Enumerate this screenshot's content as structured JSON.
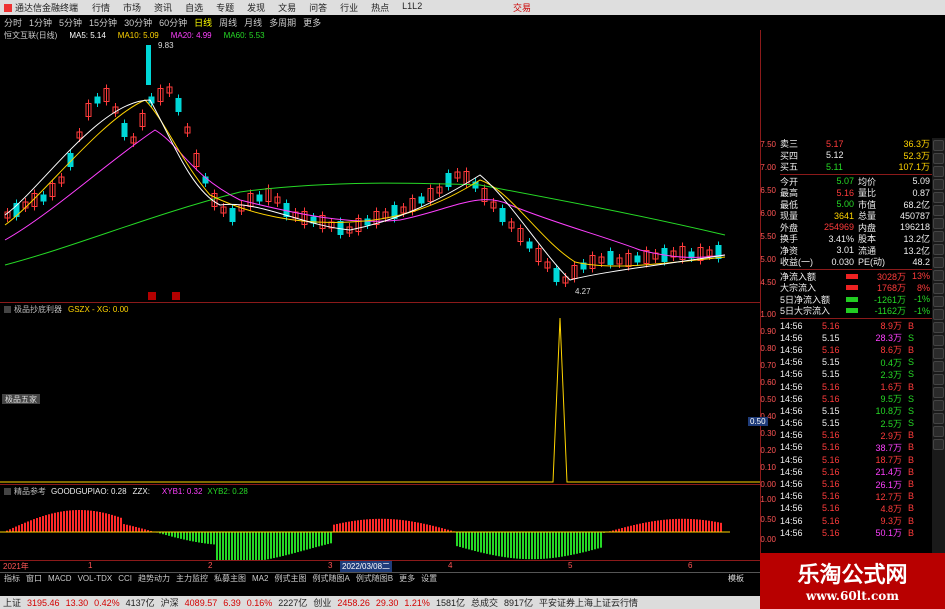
{
  "titlebar": {
    "app_title": "通达信金融终端",
    "menus": [
      "行情",
      "市场",
      "资讯",
      "自选",
      "专题",
      "发现",
      "文易",
      "问答",
      "行业",
      "热点",
      "L1L2"
    ],
    "close": "交易"
  },
  "periodbar": {
    "items": [
      "分时",
      "1分钟",
      "5分钟",
      "15分钟",
      "30分钟",
      "60分钟",
      "日线",
      "周线",
      "月线",
      "多周期",
      "更多"
    ],
    "active": "日线"
  },
  "main_chart": {
    "stock_title": "恒文互联(日线)",
    "ma": [
      {
        "label": "MA5: 5.14",
        "color": "#ffffff"
      },
      {
        "label": "MA10: 5.09",
        "color": "#ffd400"
      },
      {
        "label": "MA20: 4.99",
        "color": "#ff40ff"
      },
      {
        "label": "MA60: 5.53",
        "color": "#26d926"
      }
    ],
    "high_label": "9.83",
    "low_label": "4.27",
    "prices": [
      "7.50",
      "7.00",
      "6.50",
      "6.00",
      "5.50",
      "5.00",
      "4.50"
    ]
  },
  "chart_data": {
    "type": "candlestick",
    "title": "恒文互联(日线)",
    "ma_lines": [
      "MA5",
      "MA10",
      "MA20",
      "MA60"
    ],
    "ma_values": [
      5.14,
      5.09,
      4.99,
      5.53
    ],
    "high": 9.83,
    "low": 4.27
  },
  "sub1": {
    "title": "极品抄底利器",
    "formula": "GSZX - XG: 0.00",
    "axis": [
      "1.00",
      "0.90",
      "0.80",
      "0.70",
      "0.60",
      "0.50",
      "0.40",
      "0.30",
      "0.20",
      "0.10",
      "0.00"
    ],
    "cursor_value": "0.50",
    "tag_label": "极品五家"
  },
  "sub2": {
    "title": "精品参考",
    "formula": "GOODGUPIAO: 0.28",
    "extra": "ZZX:",
    "xyb1": "XYB1: 0.32",
    "xyb2": "XYB2: 0.28",
    "axis": [
      "1.00",
      "0.50",
      "0.00"
    ]
  },
  "date_axis": {
    "left": "2021年",
    "marker": "2022/03/08二",
    "ticks": [
      "1",
      "2",
      "3",
      "4",
      "5",
      "6"
    ]
  },
  "bottom_tabs": [
    "指标",
    "窗口",
    "MACD",
    "VOL-TDX",
    "CCI",
    "趋势动力",
    "主力监控",
    "私募主图",
    "MA2",
    "例式主图",
    "例式随图A",
    "例式随图B",
    "更多",
    "设置"
  ],
  "bottom_right": "模板",
  "quote": {
    "orders": [
      {
        "label": "卖三",
        "price": "5.17",
        "vol": "36.3万",
        "pc": "red"
      },
      {
        "label": "买四",
        "price": "5.12",
        "vol": "52.3万",
        "pc": "wht"
      },
      {
        "label": "买五",
        "price": "5.11",
        "vol": "107.1万",
        "pc": "grn"
      }
    ],
    "stats": [
      {
        "l": "今开",
        "v": "5.07",
        "c": "grn",
        "l2": "均价",
        "v2": "5.09"
      },
      {
        "l": "最高",
        "v": "5.16",
        "c": "red",
        "l2": "量比",
        "v2": "0.87"
      },
      {
        "l": "最低",
        "v": "5.00",
        "c": "grn",
        "l2": "市值",
        "v2": "68.2亿"
      },
      {
        "l": "现量",
        "v": "3641",
        "c": "yel",
        "l2": "总量",
        "v2": "450787"
      },
      {
        "l": "外盘",
        "v": "254969",
        "c": "red",
        "l2": "内盘",
        "v2": "196218"
      },
      {
        "l": "换手",
        "v": "3.41%",
        "c": "wht",
        "l2": "股本",
        "v2": "13.2亿"
      },
      {
        "l": "净资",
        "v": "3.01",
        "c": "wht",
        "l2": "流通",
        "v2": "13.2亿"
      },
      {
        "l": "收益(一)",
        "v": "0.030",
        "c": "wht",
        "l2": "PE(动)",
        "v2": "48.2"
      }
    ],
    "flows": [
      {
        "l": "净流入额",
        "v": "3028万",
        "p": "13%",
        "c": "red"
      },
      {
        "l": "大宗流入",
        "v": "1768万",
        "p": "8%",
        "c": "red"
      },
      {
        "l": "5日净流入额",
        "v": "-1261万",
        "p": "-1%",
        "c": "grn"
      },
      {
        "l": "5日大宗流入",
        "v": "-1162万",
        "p": "-1%",
        "c": "grn"
      }
    ],
    "ticks": [
      [
        "14:56",
        "5.16",
        "8.9万",
        "B"
      ],
      [
        "14:56",
        "5.15",
        "28.3万",
        "S"
      ],
      [
        "14:56",
        "5.16",
        "8.6万",
        "B"
      ],
      [
        "14:56",
        "5.15",
        "0.4万",
        "S"
      ],
      [
        "14:56",
        "5.15",
        "2.3万",
        "S"
      ],
      [
        "14:56",
        "5.16",
        "1.6万",
        "B"
      ],
      [
        "14:56",
        "5.16",
        "9.5万",
        "S"
      ],
      [
        "14:56",
        "5.15",
        "10.8万",
        "S"
      ],
      [
        "14:56",
        "5.15",
        "2.5万",
        "S"
      ],
      [
        "14:56",
        "5.16",
        "2.9万",
        "B"
      ],
      [
        "14:56",
        "5.16",
        "38.7万",
        "B"
      ],
      [
        "14:56",
        "5.16",
        "18.7万",
        "B"
      ],
      [
        "14:56",
        "5.16",
        "21.4万",
        "B"
      ],
      [
        "14:56",
        "5.16",
        "26.1万",
        "B"
      ],
      [
        "14:56",
        "5.16",
        "12.7万",
        "B"
      ],
      [
        "14:56",
        "5.16",
        "4.8万",
        "B"
      ],
      [
        "14:56",
        "5.16",
        "9.3万",
        "B"
      ],
      [
        "14:56",
        "5.16",
        "50.1万",
        "B"
      ]
    ]
  },
  "statusbar": {
    "items": [
      {
        "t": "上证",
        "c": "wht"
      },
      {
        "t": "3195.46",
        "c": "red"
      },
      {
        "t": "13.30",
        "c": "red"
      },
      {
        "t": "0.42%",
        "c": "red"
      },
      {
        "t": "4137亿",
        "c": "wht"
      },
      {
        "t": "沪深",
        "c": "wht"
      },
      {
        "t": "4089.57",
        "c": "red"
      },
      {
        "t": "6.39",
        "c": "red"
      },
      {
        "t": "0.16%",
        "c": "red"
      },
      {
        "t": "2227亿",
        "c": "wht"
      },
      {
        "t": "创业",
        "c": "wht"
      },
      {
        "t": "2458.26",
        "c": "red"
      },
      {
        "t": "29.30",
        "c": "red"
      },
      {
        "t": "1.21%",
        "c": "red"
      },
      {
        "t": "1581亿",
        "c": "wht"
      },
      {
        "t": "总成交",
        "c": "wht"
      },
      {
        "t": "8917亿",
        "c": "wht"
      },
      {
        "t": "平安证券上海上证云行情",
        "c": "wht"
      }
    ]
  },
  "watermark": {
    "title": "乐淘公式网",
    "url": "www.60lt.com"
  }
}
